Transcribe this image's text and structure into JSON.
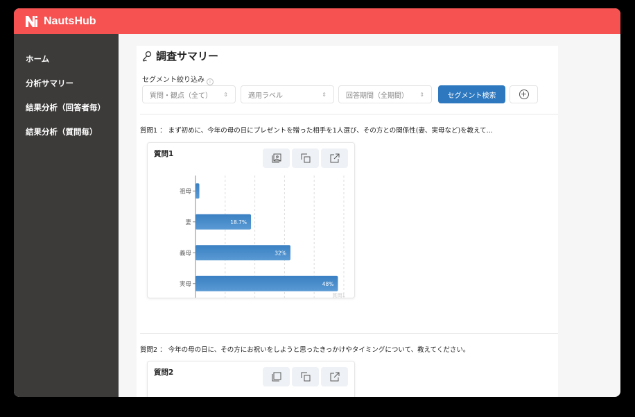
{
  "app": {
    "name": "NautsHub",
    "brand_color": "#f65252"
  },
  "sidebar": {
    "items": [
      {
        "label": "ホーム"
      },
      {
        "label": "分析サマリー"
      },
      {
        "label": "結果分析（回答者毎）"
      },
      {
        "label": "結果分析（質問毎）"
      }
    ]
  },
  "page": {
    "title": "調査サマリー",
    "title_icon": "microphone-icon"
  },
  "segment": {
    "label": "セグメント絞り込み",
    "filters": [
      {
        "value": "質問・観点（全て）"
      },
      {
        "value": "適用ラベル"
      },
      {
        "value": "回答期間（全期間）"
      }
    ],
    "search_button": "セグメント検索",
    "accent": "#2d78bf"
  },
  "questions": [
    {
      "text": "質問1 ： まず初めに、今年の母の日にプレゼントを贈った相手を1人選び、その方との関係性(妻、実母など)を教えて...",
      "card_title": "質問1"
    },
    {
      "text": "質問2 ： 今年の母の日に、その方にお祝いをしようと思ったきっかけやタイミングについて、教えてください。",
      "card_title": "質問2"
    }
  ],
  "chart_data": {
    "type": "bar",
    "orientation": "horizontal",
    "categories": [
      "祖母",
      "妻",
      "義母",
      "実母"
    ],
    "values": [
      1.3,
      18.7,
      32,
      48
    ],
    "data_labels": [
      "",
      "18.7%",
      "32%",
      "48%"
    ],
    "xlim": [
      0,
      50
    ],
    "grid": true,
    "watermark": "質問1",
    "bar_color": "#3a80c2"
  }
}
